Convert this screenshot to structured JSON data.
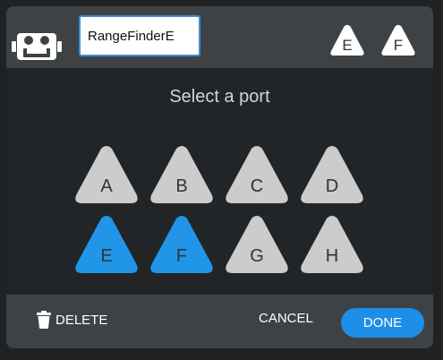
{
  "header": {
    "device_icon": "robot-sensor-icon",
    "name_value": "RangeFinderE",
    "assigned_ports": [
      {
        "label": "E",
        "color": "#ffffff"
      },
      {
        "label": "F",
        "color": "#ffffff"
      }
    ]
  },
  "title": "Select a port",
  "ports": [
    {
      "label": "A",
      "selected": false
    },
    {
      "label": "B",
      "selected": false
    },
    {
      "label": "C",
      "selected": false
    },
    {
      "label": "D",
      "selected": false
    },
    {
      "label": "E",
      "selected": true
    },
    {
      "label": "F",
      "selected": true
    },
    {
      "label": "G",
      "selected": false
    },
    {
      "label": "H",
      "selected": false
    }
  ],
  "colors": {
    "port_default": "#cccccc",
    "port_selected": "#2196e8",
    "accent": "#1d8fe8"
  },
  "footer": {
    "delete_label": "DELETE",
    "delete_icon": "trash-icon",
    "cancel_label": "CANCEL",
    "done_label": "DONE"
  }
}
